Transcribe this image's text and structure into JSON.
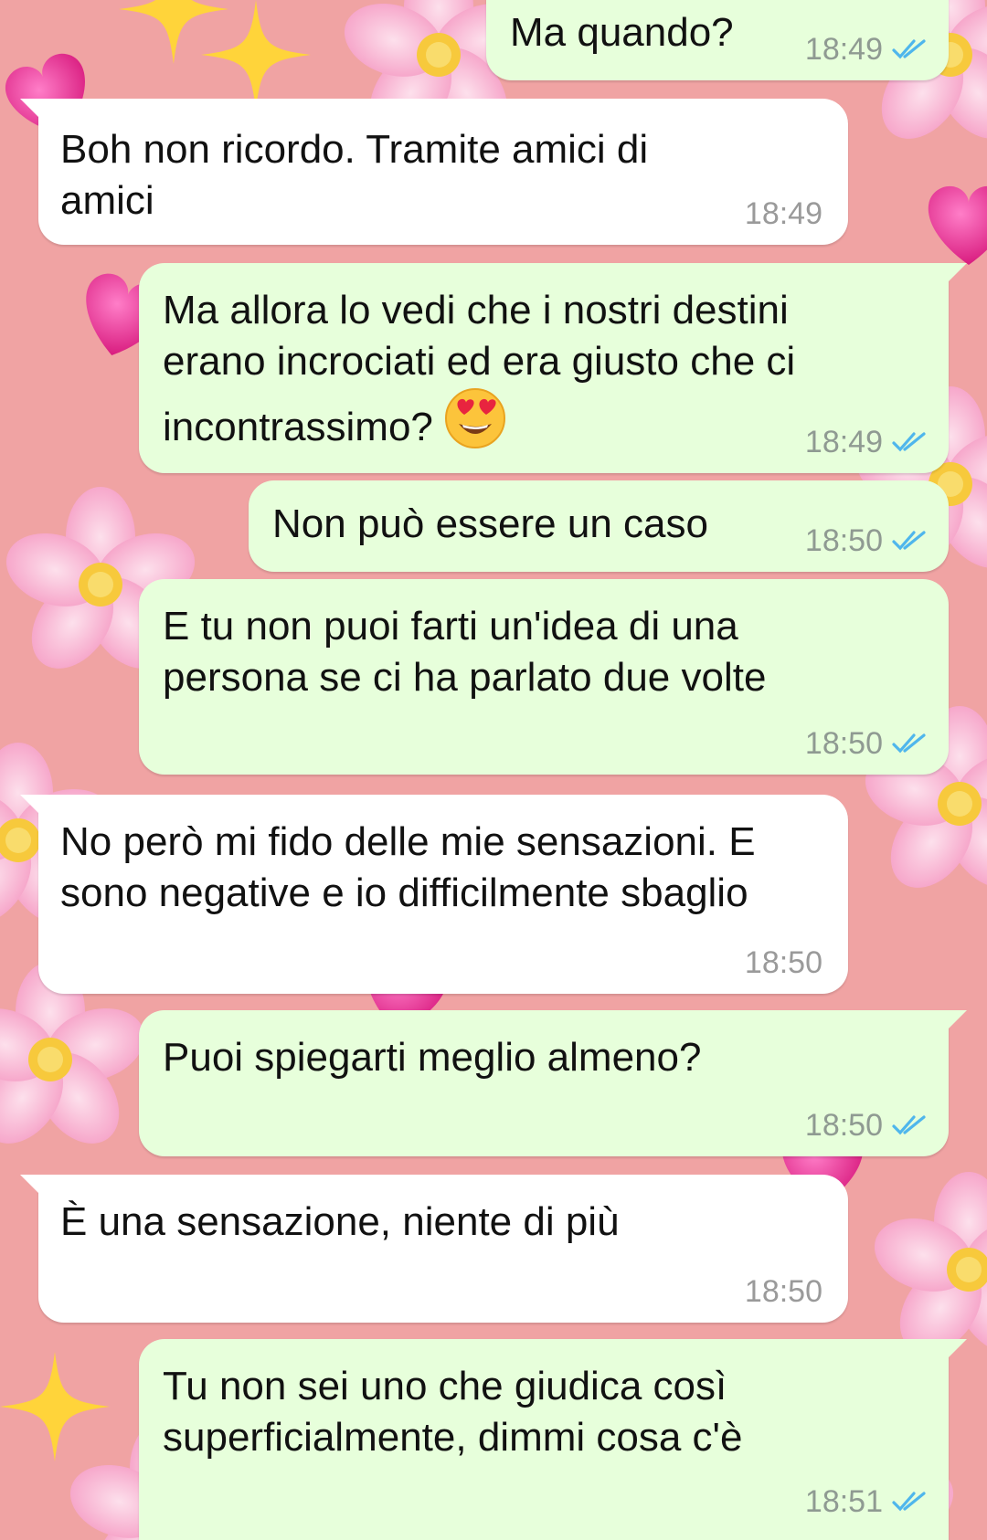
{
  "colors": {
    "wallpaper": "#f0a3a3",
    "incoming_bubble": "#ffffff",
    "outgoing_bubble": "#e7ffdb",
    "read_ticks": "#4fb6ec",
    "timestamp": "#8f9a92"
  },
  "messages": [
    {
      "direction": "out",
      "text": "Ma quando?",
      "time": "18:49",
      "status": "read"
    },
    {
      "direction": "in",
      "text": "Boh non ricordo. Tramite amici di amici",
      "time": "18:49"
    },
    {
      "direction": "out",
      "text": "Ma allora lo vedi che i nostri destini erano incrociati ed era giusto che ci incontrassimo?",
      "emoji": "smiling-face-with-heart-eyes",
      "time": "18:49",
      "status": "read"
    },
    {
      "direction": "out",
      "text": "Non può essere un caso",
      "time": "18:50",
      "status": "read"
    },
    {
      "direction": "out",
      "text": "E tu non puoi farti un'idea di una persona se ci ha parlato due volte",
      "time": "18:50",
      "status": "read"
    },
    {
      "direction": "in",
      "text": "No però mi fido delle mie sensazioni. E sono negative e io difficilmente sbaglio",
      "time": "18:50"
    },
    {
      "direction": "out",
      "text": "Puoi spiegarti meglio almeno?",
      "time": "18:50",
      "status": "read"
    },
    {
      "direction": "in",
      "text": "È una sensazione, niente di più",
      "time": "18:50"
    },
    {
      "direction": "out",
      "text": "Tu non sei uno che giudica così superficialmente, dimmi cosa c'è",
      "time": "18:51",
      "status": "read"
    }
  ]
}
